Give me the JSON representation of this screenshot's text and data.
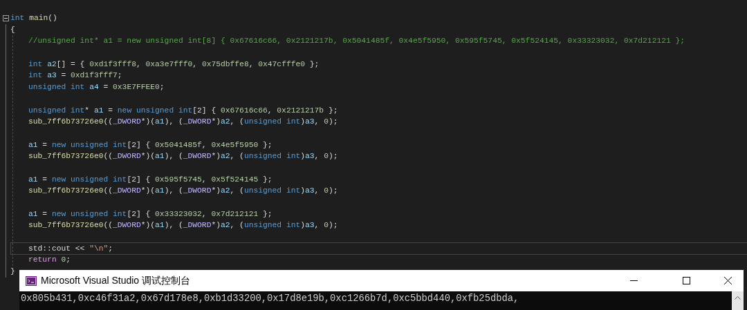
{
  "editor": {
    "signature": [
      {
        "kind": "kw",
        "text": "int "
      },
      {
        "kind": "fn",
        "text": "main"
      },
      {
        "kind": "op",
        "text": "()"
      }
    ],
    "open_brace": "{",
    "body": [
      {
        "kind": "code",
        "current": false,
        "tokens": [
          {
            "kind": "cm",
            "text": "//unsigned int* a1 = new unsigned int[8] { 0x67616c66, 0x2121217b, 0x5041485f, 0x4e5f5950, 0x595f5745, 0x5f524145, 0x33323032, 0x7d212121 };"
          }
        ]
      },
      {
        "kind": "blank"
      },
      {
        "kind": "code",
        "current": false,
        "tokens": [
          {
            "kind": "kw",
            "text": "int "
          },
          {
            "kind": "var",
            "text": "a2"
          },
          {
            "kind": "op",
            "text": "[] = { "
          },
          {
            "kind": "num",
            "text": "0xd1f3fff8"
          },
          {
            "kind": "op",
            "text": ", "
          },
          {
            "kind": "num",
            "text": "0xa3e7fff0"
          },
          {
            "kind": "op",
            "text": ", "
          },
          {
            "kind": "num",
            "text": "0x75dbffe8"
          },
          {
            "kind": "op",
            "text": ", "
          },
          {
            "kind": "num",
            "text": "0x47cfffe0"
          },
          {
            "kind": "op",
            "text": " };"
          }
        ]
      },
      {
        "kind": "code",
        "current": false,
        "tokens": [
          {
            "kind": "kw",
            "text": "int "
          },
          {
            "kind": "var",
            "text": "a3"
          },
          {
            "kind": "op",
            "text": " = "
          },
          {
            "kind": "num",
            "text": "0xd1f3fff7"
          },
          {
            "kind": "op",
            "text": ";"
          }
        ]
      },
      {
        "kind": "code",
        "current": false,
        "tokens": [
          {
            "kind": "kw",
            "text": "unsigned int "
          },
          {
            "kind": "var",
            "text": "a4"
          },
          {
            "kind": "op",
            "text": " = "
          },
          {
            "kind": "num",
            "text": "0x3E7FFEE0"
          },
          {
            "kind": "op",
            "text": ";"
          }
        ]
      },
      {
        "kind": "blank"
      },
      {
        "kind": "code",
        "current": false,
        "tokens": [
          {
            "kind": "kw",
            "text": "unsigned int"
          },
          {
            "kind": "op",
            "text": "* "
          },
          {
            "kind": "var",
            "text": "a1"
          },
          {
            "kind": "op",
            "text": " = "
          },
          {
            "kind": "kw",
            "text": "new unsigned int"
          },
          {
            "kind": "op",
            "text": "[2] { "
          },
          {
            "kind": "num",
            "text": "0x67616c66"
          },
          {
            "kind": "op",
            "text": ", "
          },
          {
            "kind": "num",
            "text": "0x2121217b"
          },
          {
            "kind": "op",
            "text": " };"
          }
        ]
      },
      {
        "kind": "code",
        "current": false,
        "tokens": [
          {
            "kind": "fn",
            "text": "sub_7ff6b73726e0"
          },
          {
            "kind": "op",
            "text": "(("
          },
          {
            "kind": "mac",
            "text": "_DWORD"
          },
          {
            "kind": "op",
            "text": "*)("
          },
          {
            "kind": "var",
            "text": "a1"
          },
          {
            "kind": "op",
            "text": "), ("
          },
          {
            "kind": "mac",
            "text": "_DWORD"
          },
          {
            "kind": "op",
            "text": "*)"
          },
          {
            "kind": "var",
            "text": "a2"
          },
          {
            "kind": "op",
            "text": ", ("
          },
          {
            "kind": "kw",
            "text": "unsigned int"
          },
          {
            "kind": "op",
            "text": ")"
          },
          {
            "kind": "var",
            "text": "a3"
          },
          {
            "kind": "op",
            "text": ", "
          },
          {
            "kind": "num",
            "text": "0"
          },
          {
            "kind": "op",
            "text": ");"
          }
        ]
      },
      {
        "kind": "blank"
      },
      {
        "kind": "code",
        "current": false,
        "tokens": [
          {
            "kind": "var",
            "text": "a1"
          },
          {
            "kind": "op",
            "text": " = "
          },
          {
            "kind": "kw",
            "text": "new unsigned int"
          },
          {
            "kind": "op",
            "text": "[2] { "
          },
          {
            "kind": "num",
            "text": "0x5041485f"
          },
          {
            "kind": "op",
            "text": ", "
          },
          {
            "kind": "num",
            "text": "0x4e5f5950"
          },
          {
            "kind": "op",
            "text": " };"
          }
        ]
      },
      {
        "kind": "code",
        "current": false,
        "tokens": [
          {
            "kind": "fn",
            "text": "sub_7ff6b73726e0"
          },
          {
            "kind": "op",
            "text": "(("
          },
          {
            "kind": "mac",
            "text": "_DWORD"
          },
          {
            "kind": "op",
            "text": "*)("
          },
          {
            "kind": "var",
            "text": "a1"
          },
          {
            "kind": "op",
            "text": "), ("
          },
          {
            "kind": "mac",
            "text": "_DWORD"
          },
          {
            "kind": "op",
            "text": "*)"
          },
          {
            "kind": "var",
            "text": "a2"
          },
          {
            "kind": "op",
            "text": ", ("
          },
          {
            "kind": "kw",
            "text": "unsigned int"
          },
          {
            "kind": "op",
            "text": ")"
          },
          {
            "kind": "var",
            "text": "a3"
          },
          {
            "kind": "op",
            "text": ", "
          },
          {
            "kind": "num",
            "text": "0"
          },
          {
            "kind": "op",
            "text": ");"
          }
        ]
      },
      {
        "kind": "blank"
      },
      {
        "kind": "code",
        "current": false,
        "tokens": [
          {
            "kind": "var",
            "text": "a1"
          },
          {
            "kind": "op",
            "text": " = "
          },
          {
            "kind": "kw",
            "text": "new unsigned int"
          },
          {
            "kind": "op",
            "text": "[2] { "
          },
          {
            "kind": "num",
            "text": "0x595f5745"
          },
          {
            "kind": "op",
            "text": ", "
          },
          {
            "kind": "num",
            "text": "0x5f524145"
          },
          {
            "kind": "op",
            "text": " };"
          }
        ]
      },
      {
        "kind": "code",
        "current": false,
        "tokens": [
          {
            "kind": "fn",
            "text": "sub_7ff6b73726e0"
          },
          {
            "kind": "op",
            "text": "(("
          },
          {
            "kind": "mac",
            "text": "_DWORD"
          },
          {
            "kind": "op",
            "text": "*)("
          },
          {
            "kind": "var",
            "text": "a1"
          },
          {
            "kind": "op",
            "text": "), ("
          },
          {
            "kind": "mac",
            "text": "_DWORD"
          },
          {
            "kind": "op",
            "text": "*)"
          },
          {
            "kind": "var",
            "text": "a2"
          },
          {
            "kind": "op",
            "text": ", ("
          },
          {
            "kind": "kw",
            "text": "unsigned int"
          },
          {
            "kind": "op",
            "text": ")"
          },
          {
            "kind": "var",
            "text": "a3"
          },
          {
            "kind": "op",
            "text": ", "
          },
          {
            "kind": "num",
            "text": "0"
          },
          {
            "kind": "op",
            "text": ");"
          }
        ]
      },
      {
        "kind": "blank"
      },
      {
        "kind": "code",
        "current": false,
        "tokens": [
          {
            "kind": "var",
            "text": "a1"
          },
          {
            "kind": "op",
            "text": " = "
          },
          {
            "kind": "kw",
            "text": "new unsigned int"
          },
          {
            "kind": "op",
            "text": "[2] { "
          },
          {
            "kind": "num",
            "text": "0x33323032"
          },
          {
            "kind": "op",
            "text": ", "
          },
          {
            "kind": "num",
            "text": "0x7d212121"
          },
          {
            "kind": "op",
            "text": " };"
          }
        ]
      },
      {
        "kind": "code",
        "current": false,
        "tokens": [
          {
            "kind": "fn",
            "text": "sub_7ff6b73726e0"
          },
          {
            "kind": "op",
            "text": "(("
          },
          {
            "kind": "mac",
            "text": "_DWORD"
          },
          {
            "kind": "op",
            "text": "*)("
          },
          {
            "kind": "var",
            "text": "a1"
          },
          {
            "kind": "op",
            "text": "), ("
          },
          {
            "kind": "mac",
            "text": "_DWORD"
          },
          {
            "kind": "op",
            "text": "*)"
          },
          {
            "kind": "var",
            "text": "a2"
          },
          {
            "kind": "op",
            "text": ", ("
          },
          {
            "kind": "kw",
            "text": "unsigned int"
          },
          {
            "kind": "op",
            "text": ")"
          },
          {
            "kind": "var",
            "text": "a3"
          },
          {
            "kind": "op",
            "text": ", "
          },
          {
            "kind": "num",
            "text": "0"
          },
          {
            "kind": "op",
            "text": ");"
          }
        ]
      },
      {
        "kind": "blank"
      },
      {
        "kind": "code",
        "current": true,
        "tokens": [
          {
            "kind": "plain",
            "text": "std::cout"
          },
          {
            "kind": "op",
            "text": " << "
          },
          {
            "kind": "str",
            "text": "\"\\n\""
          },
          {
            "kind": "op",
            "text": ";"
          }
        ]
      },
      {
        "kind": "code",
        "current": false,
        "tokens": [
          {
            "kind": "ctl",
            "text": "return "
          },
          {
            "kind": "num",
            "text": "0"
          },
          {
            "kind": "op",
            "text": ";"
          }
        ]
      }
    ],
    "close_brace": "}"
  },
  "console": {
    "title": "Microsoft Visual Studio 调试控制台",
    "output": "0x805b431,0xc46f31a2,0x67d178e8,0xb1d33200,0x17d8e19b,0xc1266b7d,0xc5bbd440,0xfb25dbda,"
  }
}
